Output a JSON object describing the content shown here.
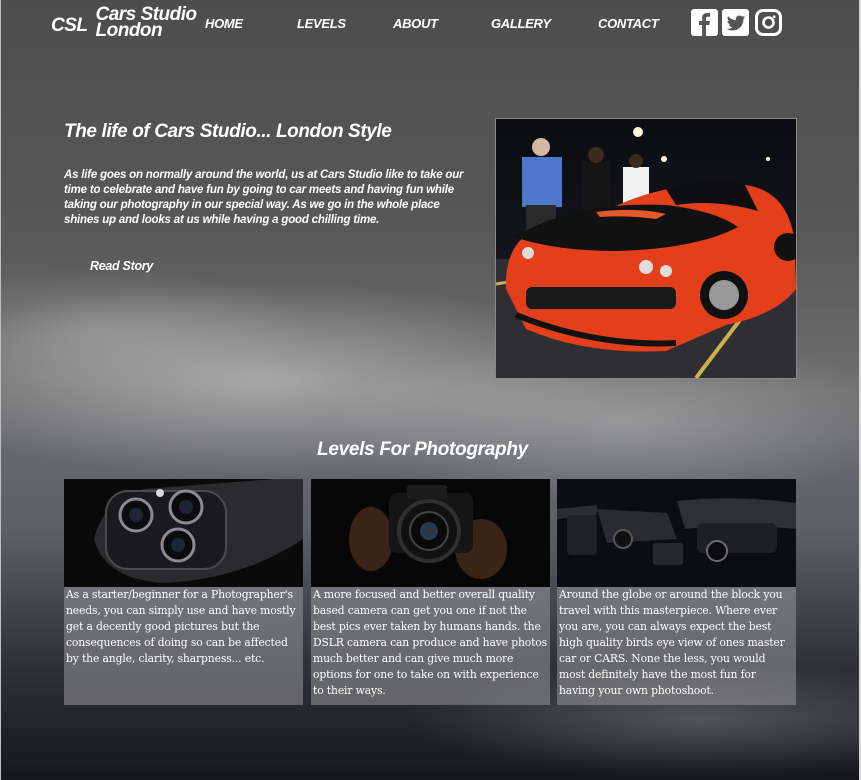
{
  "header": {
    "logo_abbr": "CSL",
    "logo_name_line1": "Cars Studio",
    "logo_name_line2": "London",
    "nav": [
      "HOME",
      "LEVELS",
      "ABOUT",
      "GALLERY",
      "CONTACT"
    ],
    "social_icons": [
      "facebook-icon",
      "twitter-icon",
      "instagram-icon"
    ]
  },
  "hero": {
    "title": "The life of Cars Studio... London Style",
    "text": "As life goes on normally around the world, us at Cars Studio like to take our time to celebrate and have fun by going to car meets and having fun while taking our photography in our special way. As we go in the whole place shines up and looks at us while having a good chilling time.",
    "cta": "Read Story",
    "photo_subject": "red-muscle-car-photo"
  },
  "levels": {
    "title": "Levels For Photography",
    "cards": [
      {
        "image": "phone-camera-photo",
        "text": "As a starter/beginner for a Photographer's needs, you can simply use and have mostly get a decently good pictures but the consequences of doing so can be affected by the angle, clarity, sharpness... etc."
      },
      {
        "image": "dslr-camera-photo",
        "text": "A more focused and better overall quality based camera can get you one if not the best pics ever taken by humans hands. the DSLR camera can produce and have photos much better and can give much more options for one to take on with experience to their ways."
      },
      {
        "image": "drone-photo",
        "text": "Around the globe or around the block you travel with this masterpiece. Where ever you are, you can always expect the best high quality birds eye view of ones master car or CARS. None the less, you would most definitely have the most fun for having your own photoshoot."
      }
    ]
  }
}
